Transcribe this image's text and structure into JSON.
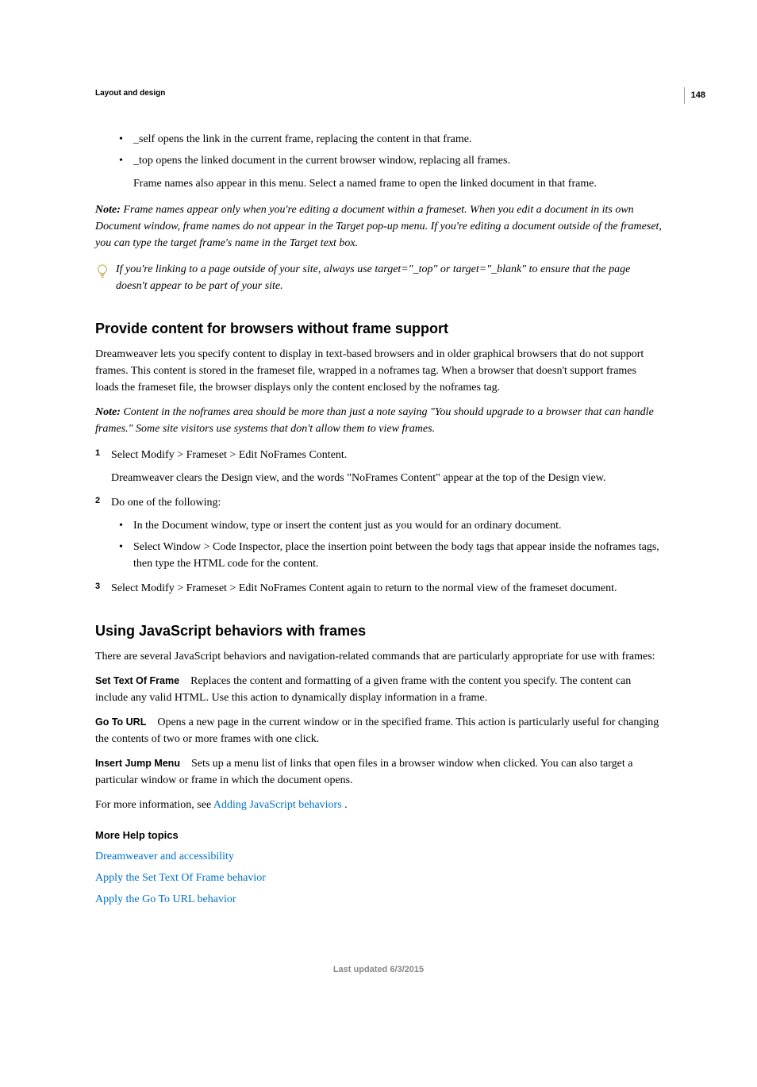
{
  "page_number": "148",
  "section_header": "Layout and design",
  "top_bullets": [
    "_self opens the link in the current frame, replacing the content in that frame.",
    "_top opens the linked document in the current browser window, replacing all frames."
  ],
  "top_indented": "Frame names also appear in this menu. Select a named frame to open the linked document in that frame.",
  "note1_label": "Note:",
  "note1_body": "Frame names appear only when you're editing a document within a frameset. When you edit a document in its own Document window, frame names do not appear in the Target pop-up menu. If you're editing a document outside of the frameset, you can type the target frame's name in the Target text box.",
  "tip_text": "If you're linking to a page outside of your site, always use target=\"_top\" or target=\"_blank\" to ensure that the page doesn't appear to be part of your site.",
  "h2_a": "Provide content for browsers without frame support",
  "p_a1": "Dreamweaver lets you specify content to display in text-based browsers and in older graphical browsers that do not support frames. This content is stored in the frameset file, wrapped in a noframes tag. When a browser that doesn't support frames loads the frameset file, the browser displays only the content enclosed by the noframes tag.",
  "note2_label": "Note:",
  "note2_body": "Content in the noframes area should be more than just a note saying \"You should upgrade to a browser that can handle frames.\" Some site visitors use systems that don't allow them to view frames.",
  "steps": [
    {
      "num": "1",
      "text": "Select Modify > Frameset > Edit NoFrames Content.",
      "after": "Dreamweaver clears the Design view, and the words \"NoFrames Content\" appear at the top of the Design view."
    },
    {
      "num": "2",
      "text": "Do one of the following:",
      "bullets": [
        "In the Document window, type or insert the content just as you would for an ordinary document.",
        "Select Window > Code Inspector, place the insertion point between the body tags that appear inside the noframes tags, then type the HTML code for the content."
      ]
    },
    {
      "num": "3",
      "text": "Select Modify > Frameset > Edit NoFrames Content again to return to the normal view of the frameset document."
    }
  ],
  "h2_b": "Using JavaScript behaviors with frames",
  "p_b1": "There are several JavaScript behaviors and navigation-related commands that are particularly appropriate for use with frames:",
  "run1_head": "Set Text Of Frame",
  "run1_body": "Replaces the content and formatting of a given frame with the content you specify. The content can include any valid HTML. Use this action to dynamically display information in a frame.",
  "run2_head": "Go To URL",
  "run2_body": "Opens a new page in the current window or in the specified frame. This action is particularly useful for changing the contents of two or more frames with one click.",
  "run3_head": "Insert Jump Menu",
  "run3_body": "Sets up a menu list of links that open files in a browser window when clicked. You can also target a particular window or frame in which the document opens.",
  "more_info_prefix": "For more information, see ",
  "more_info_link": "Adding JavaScript behaviors",
  "more_info_suffix": " .",
  "help_heading": "More Help topics",
  "help_links": [
    "Dreamweaver and accessibility",
    "Apply the Set Text Of Frame behavior",
    "Apply the Go To URL behavior"
  ],
  "footer": "Last updated 6/3/2015"
}
